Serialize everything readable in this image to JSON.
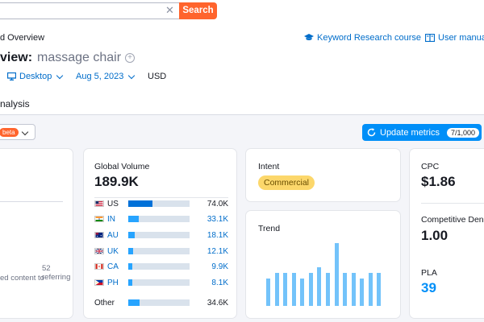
{
  "search": {
    "button_label": "Search"
  },
  "header": {
    "breadcrumb": "d Overview",
    "title_prefix": "view:",
    "keyword": "massage chair",
    "links": [
      "Keyword Research course",
      "User manual"
    ],
    "device": "Desktop",
    "date": "Aug 5, 2023",
    "currency": "USD"
  },
  "section_title": "nalysis",
  "beta_label": "beta",
  "update": {
    "label": "Update metrics",
    "count": "7/1,000"
  },
  "left_card": {
    "text_line1": "52 referring",
    "text_line2": "ed content to"
  },
  "volume": {
    "label": "Global Volume",
    "value": "189.9K",
    "rows": [
      {
        "cc": "US",
        "value": "74.0K",
        "share": 0.39,
        "color": "#0071d8"
      },
      {
        "cc": "IN",
        "value": "33.1K",
        "share": 0.17,
        "color": "#27a4ff"
      },
      {
        "cc": "AU",
        "value": "18.1K",
        "share": 0.1,
        "color": "#27a4ff"
      },
      {
        "cc": "UK",
        "value": "12.1K",
        "share": 0.08,
        "color": "#27a4ff"
      },
      {
        "cc": "CA",
        "value": "9.9K",
        "share": 0.07,
        "color": "#27a4ff"
      },
      {
        "cc": "PH",
        "value": "8.1K",
        "share": 0.06,
        "color": "#27a4ff"
      },
      {
        "cc": "Other",
        "value": "34.6K",
        "share": 0.18,
        "color": "#27a4ff"
      }
    ]
  },
  "intent": {
    "label": "Intent",
    "value": "Commercial"
  },
  "trend": {
    "label": "Trend",
    "values": [
      0.44,
      0.52,
      0.52,
      0.52,
      0.43,
      0.52,
      0.62,
      0.52,
      1.0,
      0.52,
      0.52,
      0.43,
      0.52,
      0.52
    ]
  },
  "cpc": {
    "label": "CPC",
    "value": "$1.86"
  },
  "comp": {
    "label": "Competitive Den",
    "value": "1.00"
  },
  "pla": {
    "label": "PLA",
    "value": "39"
  }
}
